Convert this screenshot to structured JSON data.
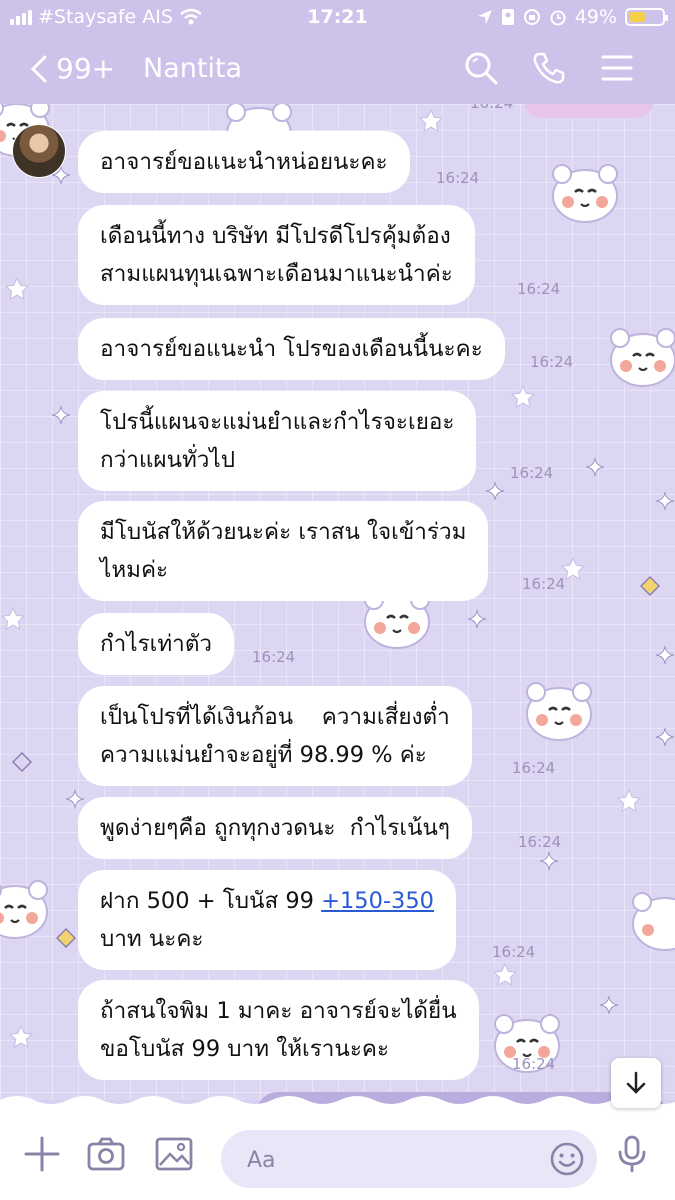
{
  "status_bar": {
    "carrier": "#Staysafe AIS",
    "time": "17:21",
    "battery_percent": "49%",
    "battery_level": 0.49
  },
  "header": {
    "back_label": "99+",
    "chat_name": "Nantita"
  },
  "top_peek_time": "16:24",
  "messages": [
    {
      "text": "อาจารย์ขอแนะนำหน่อยนะคะ",
      "time": "16:24"
    },
    {
      "text": "เดือนนี้ทาง บริษัท มีโปรดีโปรคุ้มต้อง\nสามแผนทุนเฉพาะเดือนมาแนะนำค่ะ",
      "time": "16:24"
    },
    {
      "text": "อาจารย์ขอแนะนำ โปรของเดือนนี้นะคะ",
      "time": "16:24"
    },
    {
      "text": "โปรนี้แผนจะแม่นยำและกำไรจะเยอะ\nกว่าแผนทั่วไป",
      "time": "16:24"
    },
    {
      "text": "มีโบนัสให้ด้วยนะค่ะ เราสน ใจเข้าร่วม\nไหมค่ะ",
      "time": "16:24"
    },
    {
      "text": "กำไรเท่าตัว",
      "time": "16:24"
    },
    {
      "text": "เป็นโปรที่ได้เงินก้อน    ความเสี่ยงต่ำ\nความแม่นยำจะอยู่ที่ 98.99 % ค่ะ",
      "time": "16:24"
    },
    {
      "text": "พูดง่ายๆคือ ถูกทุกงวดนะ  กำไรเน้นๆ",
      "time": "16:24"
    },
    {
      "text_before": "ฝาก 500 + โบนัส 99 ",
      "link": "+150-350",
      "text_after": "\nบาท นะคะ",
      "time": "16:24"
    },
    {
      "text": "ถ้าสนใจพิม 1 มาคะ อาจารย์จะได้ยื่น\nขอโบนัส 99 บาท ให้เรานะคะ",
      "time": "16:24"
    }
  ],
  "input": {
    "placeholder": "Aa"
  },
  "colors": {
    "header_bg": "#cdc3ea",
    "chat_bg": "#ddd6f3",
    "link": "#2a5bd7"
  }
}
